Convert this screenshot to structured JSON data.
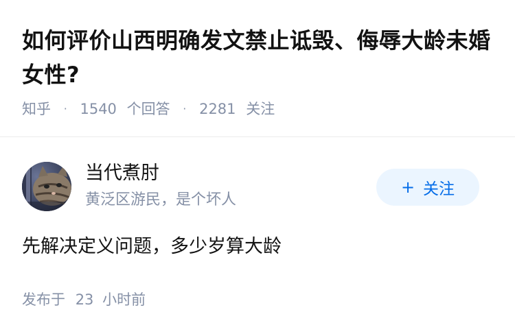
{
  "question": {
    "title": "如何评价山西明确发文禁止诋毁、侮辱大龄未婚女性?",
    "source": "知乎",
    "answer_count": "1540",
    "answer_label": "个回答",
    "follower_count": "2281",
    "follower_label": "关注",
    "separator": "·"
  },
  "answer": {
    "author_name": "当代煮肘",
    "author_headline": "黄泛区游民，是个坏人",
    "follow_button": {
      "icon": "plus-icon",
      "plus": "+",
      "label": "关注",
      "color": "#056de8",
      "background": "#ebf5ff"
    },
    "content": "先解决定义问题，多少岁算大龄",
    "published_label": "发布于",
    "published_value": "23",
    "published_unit": "小时前"
  },
  "colors": {
    "text_primary": "#121212",
    "text_secondary": "#8590a6",
    "divider": "#ebebeb"
  }
}
